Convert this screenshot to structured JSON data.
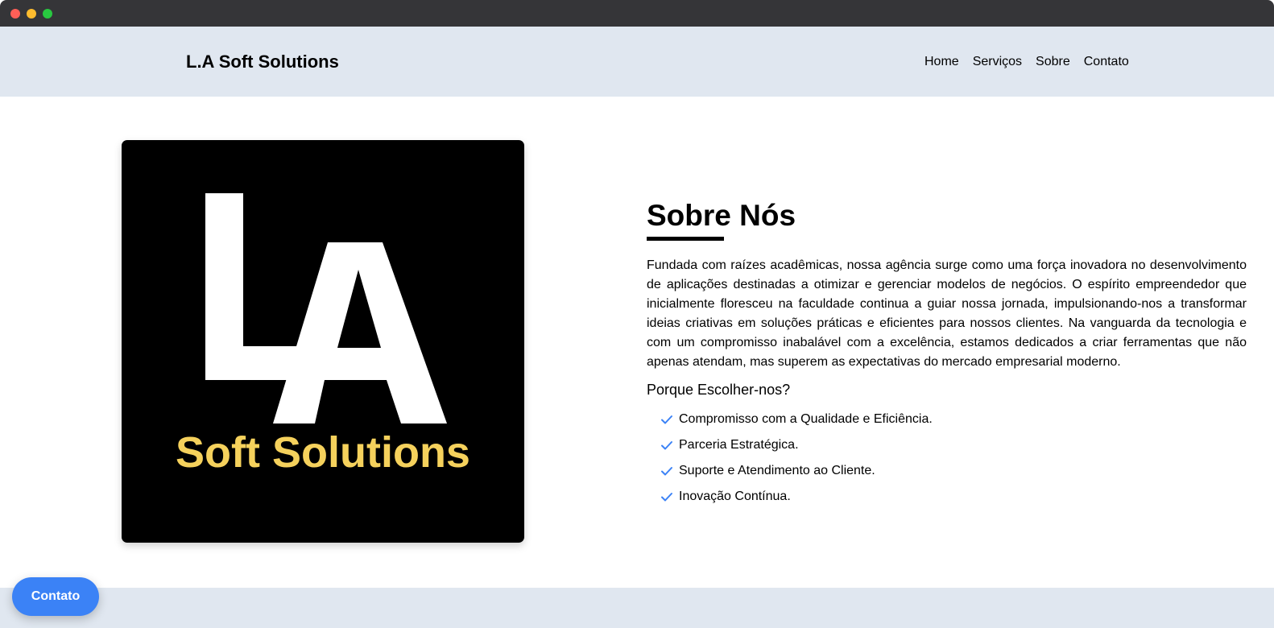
{
  "header": {
    "brand": "L.A Soft Solutions",
    "nav": [
      "Home",
      "Serviços",
      "Sobre",
      "Contato"
    ]
  },
  "logo": {
    "letters": "LA",
    "caption": "Soft Solutions",
    "caption_color": "#f5d15c",
    "background": "#000000"
  },
  "about": {
    "title": "Sobre Nós",
    "paragraph": "Fundada com raízes acadêmicas, nossa agência surge como uma força inovadora no desenvolvimento de aplicações destinadas a otimizar e gerenciar modelos de negócios. O espírito empreendedor que inicialmente floresceu na faculdade continua a guiar nossa jornada, impulsionando-nos a transformar ideias criativas em soluções práticas e eficientes para nossos clientes. Na vanguarda da tecnologia e com um compromisso inabalável com a excelência, estamos dedicados a criar ferramentas que não apenas atendam, mas superem as expectativas do mercado empresarial moderno.",
    "subtitle": "Porque Escolher-nos?",
    "features": [
      "Compromisso com a Qualidade e Eficiência.",
      "Parceria Estratégica.",
      "Suporte e Atendimento ao Cliente.",
      "Inovação Contínua."
    ]
  },
  "fab": {
    "label": "Contato"
  },
  "colors": {
    "accent": "#3b82f6",
    "navbar_bg": "#e0e7f0",
    "window_chrome": "#353538"
  },
  "icons": {
    "feature": "check-icon"
  }
}
